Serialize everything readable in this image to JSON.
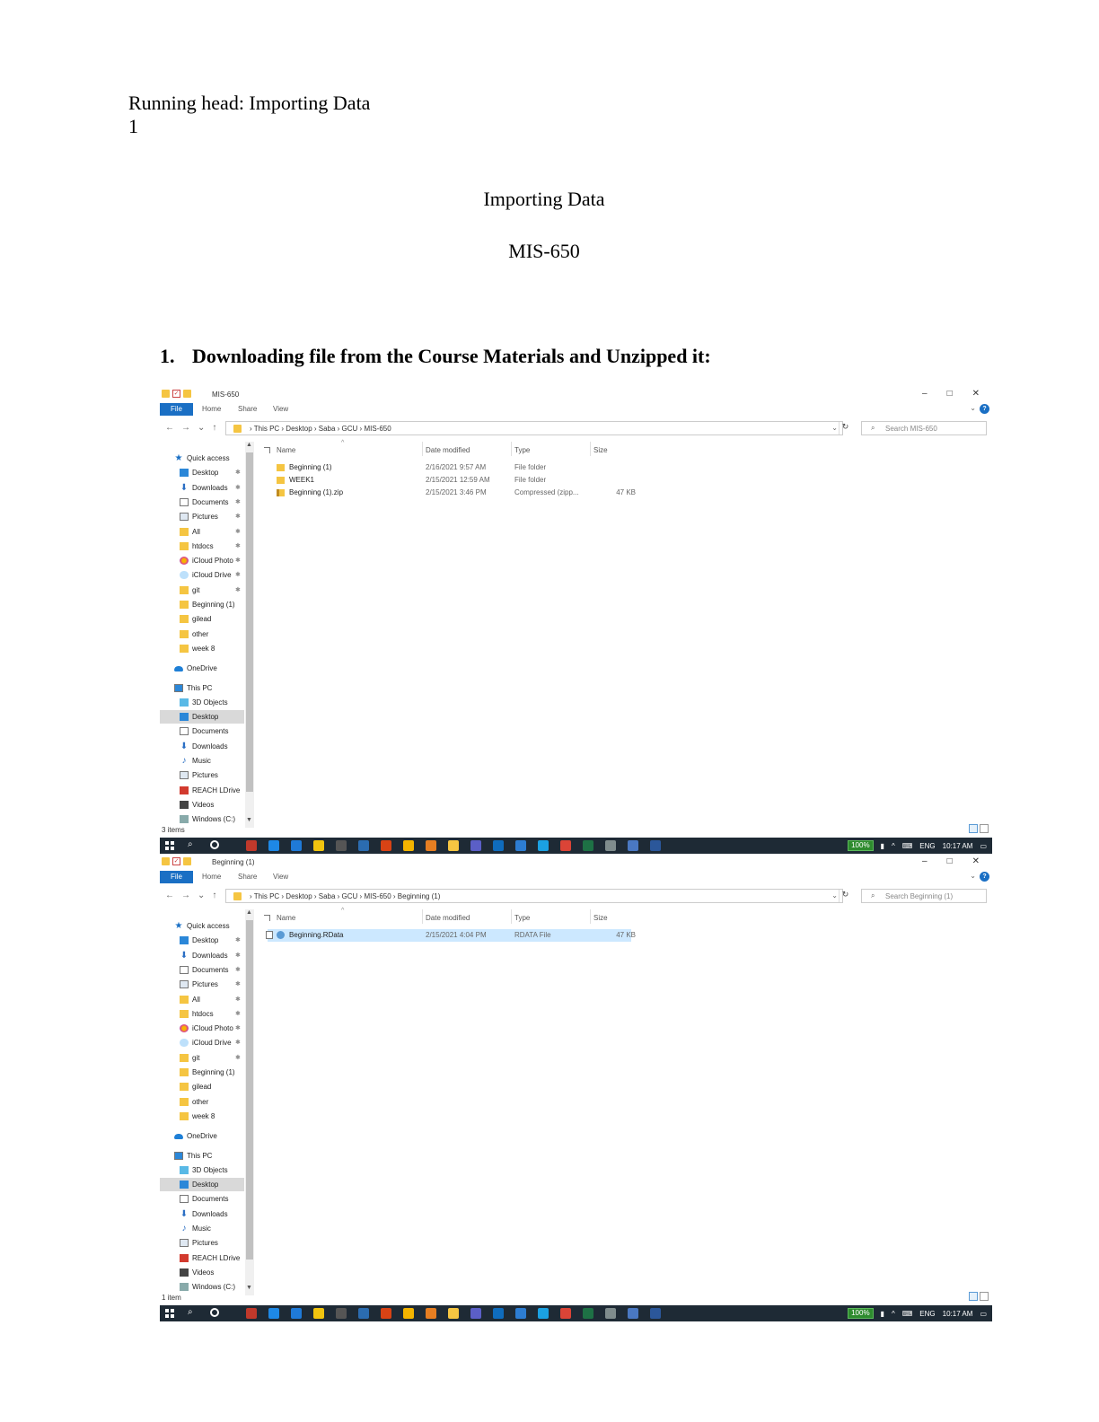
{
  "document": {
    "running_head": "Running head: Importing Data",
    "page_number": "1",
    "title": "Importing Data",
    "course": "MIS-650",
    "heading_number": "1.",
    "heading_text": "Downloading file from the Course Materials and Unzipped it:"
  },
  "screenshots": [
    {
      "window_title": "MIS-650",
      "ribbon_tabs": [
        "File",
        "Home",
        "Share",
        "View"
      ],
      "address": "›  This PC  ›  Desktop  ›  Saba  ›  GCU  ›  MIS-650",
      "search_placeholder": "Search MIS-650",
      "columns": [
        "Name",
        "Date modified",
        "Type",
        "Size"
      ],
      "files": [
        {
          "name": "Beginning (1)",
          "date": "2/16/2021 9:57 AM",
          "type": "File folder",
          "size": "",
          "icon": "folder-icon"
        },
        {
          "name": "WEEK1",
          "date": "2/15/2021 12:59 AM",
          "type": "File folder",
          "size": "",
          "icon": "folder-icon"
        },
        {
          "name": "Beginning (1).zip",
          "date": "2/15/2021 3:46 PM",
          "type": "Compressed (zipp...",
          "size": "47 KB",
          "icon": "zip-icon"
        }
      ],
      "status": "3 items"
    },
    {
      "window_title": "Beginning (1)",
      "ribbon_tabs": [
        "File",
        "Home",
        "Share",
        "View"
      ],
      "address": "›  This PC  ›  Desktop  ›  Saba  ›  GCU  ›  MIS-650  ›  Beginning (1)",
      "search_placeholder": "Search Beginning (1)",
      "columns": [
        "Name",
        "Date modified",
        "Type",
        "Size"
      ],
      "files": [
        {
          "name": "Beginning.RData",
          "date": "2/15/2021 4:04 PM",
          "type": "RDATA File",
          "size": "47 KB",
          "icon": "rdata-icon"
        }
      ],
      "status": "1 item"
    }
  ],
  "nav_items": [
    {
      "label": "Quick access",
      "icon": "star-icon",
      "pinned": false
    },
    {
      "label": "Desktop",
      "icon": "desktop-icon",
      "pinned": true
    },
    {
      "label": "Downloads",
      "icon": "download-icon",
      "pinned": true
    },
    {
      "label": "Documents",
      "icon": "document-icon",
      "pinned": true
    },
    {
      "label": "Pictures",
      "icon": "pictures-icon",
      "pinned": true
    },
    {
      "label": "All",
      "icon": "folder-icon",
      "pinned": true
    },
    {
      "label": "htdocs",
      "icon": "folder-icon",
      "pinned": true
    },
    {
      "label": "iCloud Photo",
      "icon": "icloud-photos-icon",
      "pinned": true
    },
    {
      "label": "iCloud Drive",
      "icon": "icloud-drive-icon",
      "pinned": true
    },
    {
      "label": "git",
      "icon": "folder-icon",
      "pinned": true
    },
    {
      "label": "Beginning (1)",
      "icon": "folder-icon",
      "pinned": false
    },
    {
      "label": "gilead",
      "icon": "folder-icon",
      "pinned": false
    },
    {
      "label": "other",
      "icon": "folder-icon",
      "pinned": false
    },
    {
      "label": "week 8",
      "icon": "folder-icon",
      "pinned": false
    },
    {
      "label": "OneDrive",
      "icon": "onedrive-icon",
      "pinned": false
    },
    {
      "label": "This PC",
      "icon": "this-pc-icon",
      "pinned": false
    },
    {
      "label": "3D Objects",
      "icon": "3d-objects-icon",
      "pinned": false
    },
    {
      "label": "Desktop",
      "icon": "desktop-icon",
      "pinned": false,
      "selected": true
    },
    {
      "label": "Documents",
      "icon": "document-icon",
      "pinned": false
    },
    {
      "label": "Downloads",
      "icon": "download-icon",
      "pinned": false
    },
    {
      "label": "Music",
      "icon": "music-icon",
      "pinned": false
    },
    {
      "label": "Pictures",
      "icon": "pictures-icon",
      "pinned": false
    },
    {
      "label": "REACH LDrive",
      "icon": "reach-drive-icon",
      "pinned": false
    },
    {
      "label": "Videos",
      "icon": "videos-icon",
      "pinned": false
    },
    {
      "label": "Windows (C:)",
      "icon": "drive-icon",
      "pinned": false
    }
  ],
  "taskbar": {
    "battery": "100%",
    "language": "ENG",
    "time": "10:17 AM",
    "apps": [
      {
        "name": "filezilla-icon",
        "color": "#c0392b"
      },
      {
        "name": "edge-icon",
        "color": "#1e88e5"
      },
      {
        "name": "vscode-icon",
        "color": "#1f7ad8"
      },
      {
        "name": "notepad-icon",
        "color": "#f1c40f"
      },
      {
        "name": "terminal-icon",
        "color": "#555555"
      },
      {
        "name": "visio-icon",
        "color": "#2b6cb0"
      },
      {
        "name": "office-icon",
        "color": "#d84315"
      },
      {
        "name": "chrome-icon",
        "color": "#f4b400"
      },
      {
        "name": "git-icon",
        "color": "#e67e22"
      },
      {
        "name": "file-explorer-icon",
        "color": "#f5c542"
      },
      {
        "name": "teams-icon",
        "color": "#5b5fc7"
      },
      {
        "name": "outlook-icon",
        "color": "#0f6cbd"
      },
      {
        "name": "remote-desktop-icon",
        "color": "#2d7dd2"
      },
      {
        "name": "ie-icon",
        "color": "#1ba1e2"
      },
      {
        "name": "chrome2-icon",
        "color": "#db4437"
      },
      {
        "name": "excel-icon",
        "color": "#1e7145"
      },
      {
        "name": "calculator-icon",
        "color": "#7f8c8d"
      },
      {
        "name": "r-icon",
        "color": "#4a78c2"
      },
      {
        "name": "word-icon",
        "color": "#2b579a"
      }
    ]
  }
}
